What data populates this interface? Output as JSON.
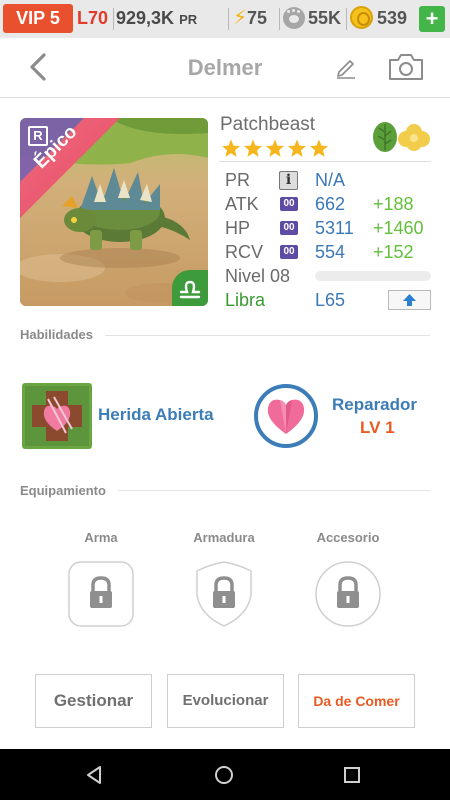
{
  "status_bar": {
    "vip": "VIP 5",
    "player_level": "L70",
    "power": "929,3K",
    "power_unit": "PR",
    "energy": "75",
    "food": "55K",
    "coins": "539",
    "add_icon": "plus-icon"
  },
  "header": {
    "title": "Delmer",
    "back_icon": "chevron-left-icon",
    "edit_icon": "pencil-icon",
    "camera_icon": "camera-icon"
  },
  "creature": {
    "species": "Patchbeast",
    "rarity": "Épico",
    "rarity_badge": "R",
    "stars": 5,
    "elements": [
      "leaf-icon",
      "cloud-icon"
    ],
    "zodiac_icon": "libra-icon",
    "stats": {
      "pr_label": "PR",
      "pr_value": "N/A",
      "atk_label": "ATK",
      "atk_badge": "00",
      "atk_value": "662",
      "atk_bonus": "+188",
      "hp_label": "HP",
      "hp_badge": "00",
      "hp_value": "5311",
      "hp_bonus": "+1460",
      "rcv_label": "RCV",
      "rcv_badge": "00",
      "rcv_value": "554",
      "rcv_bonus": "+152",
      "level_label": "Nivel 08",
      "level_progress": 0,
      "sign_label": "Libra",
      "sign_level": "L65"
    }
  },
  "skills": {
    "title": "Habilidades",
    "active_name": "Herida Abierta",
    "passive_name": "Reparador",
    "passive_level": "LV 1"
  },
  "equipment": {
    "title": "Equipamiento",
    "weapon": "Arma",
    "armor": "Armadura",
    "accessory": "Accesorio"
  },
  "actions": {
    "manage": "Gestionar",
    "evolve": "Evolucionar",
    "feed": "Da de Comer"
  },
  "colors": {
    "accent_blue": "#3c7db8",
    "bonus_green": "#62c03a",
    "feed_orange": "#ea5a22",
    "vip_red": "#e8502e"
  }
}
